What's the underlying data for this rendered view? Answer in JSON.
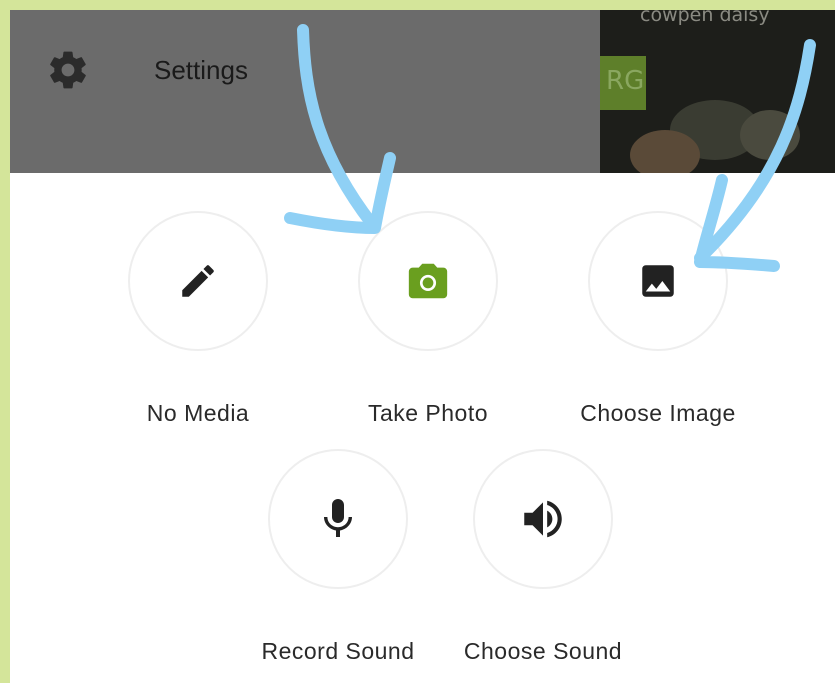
{
  "header": {
    "settings_label": "Settings",
    "photo_caption": "cowpen daisy",
    "photo_tag": "RG"
  },
  "media_options": [
    {
      "label": "No Media",
      "icon": "pencil-icon"
    },
    {
      "label": "Take Photo",
      "icon": "camera-icon"
    },
    {
      "label": "Choose Image",
      "icon": "image-icon"
    },
    {
      "label": "Record Sound",
      "icon": "microphone-icon"
    },
    {
      "label": "Choose Sound",
      "icon": "speaker-icon"
    }
  ],
  "colors": {
    "background": "#d4e59a",
    "header": "#6b6b6b",
    "accent_green": "#6a9f1f",
    "arrow_blue": "#8fd0f5",
    "icon_dark": "#222222"
  }
}
